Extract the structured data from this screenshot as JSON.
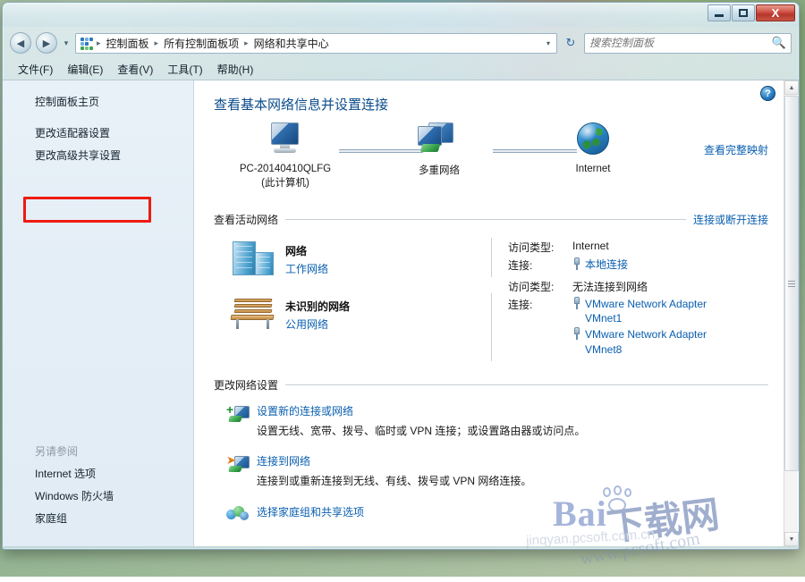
{
  "window": {
    "minimize_label": "–",
    "maximize_label": "□",
    "close_label": "X"
  },
  "navbar": {
    "back_label": "◀",
    "forward_label": "▶",
    "history_caret": "▾",
    "breadcrumbs": [
      "控制面板",
      "所有控制面板项",
      "网络和共享中心"
    ],
    "separator": "▸",
    "dropdown_caret": "▾",
    "refresh_label": "↻",
    "search_placeholder": "搜索控制面板",
    "search_value": ""
  },
  "menubar": {
    "items": [
      "文件(F)",
      "编辑(E)",
      "查看(V)",
      "工具(T)",
      "帮助(H)"
    ]
  },
  "sidebar": {
    "items": [
      {
        "label": "控制面板主页",
        "highlighted": false
      },
      {
        "label": "更改适配器设置",
        "highlighted": true
      },
      {
        "label": "更改高级共享设置",
        "highlighted": false
      }
    ],
    "see_also_header": "另请参阅",
    "see_also_items": [
      "Internet 选项",
      "Windows 防火墙",
      "家庭组"
    ],
    "highlight_color": "#ee1b11"
  },
  "content": {
    "help_label": "?",
    "page_title": "查看基本网络信息并设置连接",
    "map": {
      "nodes": [
        {
          "icon": "computer-monitor-icon",
          "label_line1": "PC-20140410QLFG",
          "label_line2": "(此计算机)"
        },
        {
          "icon": "multiple-networks-icon",
          "label_line1": "多重网络",
          "label_line2": ""
        },
        {
          "icon": "internet-globe-icon",
          "label_line1": "Internet",
          "label_line2": ""
        }
      ],
      "full_map_link": "查看完整映射"
    },
    "active_networks": {
      "title": "查看活动网络",
      "link": "连接或断开连接",
      "access_label": "访问类型:",
      "connection_label": "连接:",
      "rows": [
        {
          "icon": "network-towers-icon",
          "name": "网络",
          "type": "工作网络",
          "access_value": "Internet",
          "connections": [
            "本地连接"
          ]
        },
        {
          "icon": "park-bench-icon",
          "name": "未识别的网络",
          "type": "公用网络",
          "access_value": "无法连接到网络",
          "connections": [
            "VMware Network Adapter VMnet1",
            "VMware Network Adapter VMnet8"
          ]
        }
      ]
    },
    "change_settings": {
      "title": "更改网络设置",
      "tasks": [
        {
          "icon": "new-connection-icon",
          "title": "设置新的连接或网络",
          "desc": "设置无线、宽带、拨号、临时或 VPN 连接；或设置路由器或访问点。"
        },
        {
          "icon": "connect-network-icon",
          "title": "连接到网络",
          "desc": "连接到或重新连接到无线、有线、拨号或 VPN 网络连接。"
        },
        {
          "icon": "homegroup-icon",
          "title": "选择家庭组和共享选项",
          "desc": ""
        }
      ]
    }
  },
  "scrollbar": {
    "up_label": "▲",
    "down_label": "▼"
  },
  "watermark": {
    "brand": "Bai",
    "brand_cn": "下载网",
    "url": "www.pcsoft.com",
    "sub": "jinqyan.pcsoft.com.cn"
  }
}
